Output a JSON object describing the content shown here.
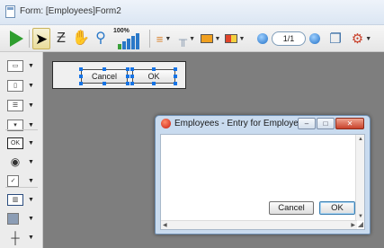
{
  "window": {
    "title": "Form: [Employees]Form2"
  },
  "toolbar": {
    "zoom_label": "100%",
    "page_field": "1/1"
  },
  "design_form": {
    "cancel_label": "Cancel",
    "ok_label": "OK"
  },
  "preview_window": {
    "title": "Employees - Entry for Employees",
    "cancel_label": "Cancel",
    "ok_label": "OK",
    "minimize_glyph": "–",
    "maximize_glyph": "□",
    "close_glyph": "✕"
  },
  "icons": {
    "run": "green-play-icon",
    "select": "arrow-pointer-icon",
    "zorder": "zorder-icon",
    "hand": "hand-pan-icon",
    "zoom": "magnifier-zoom-icon",
    "accent": "#1473e6"
  }
}
